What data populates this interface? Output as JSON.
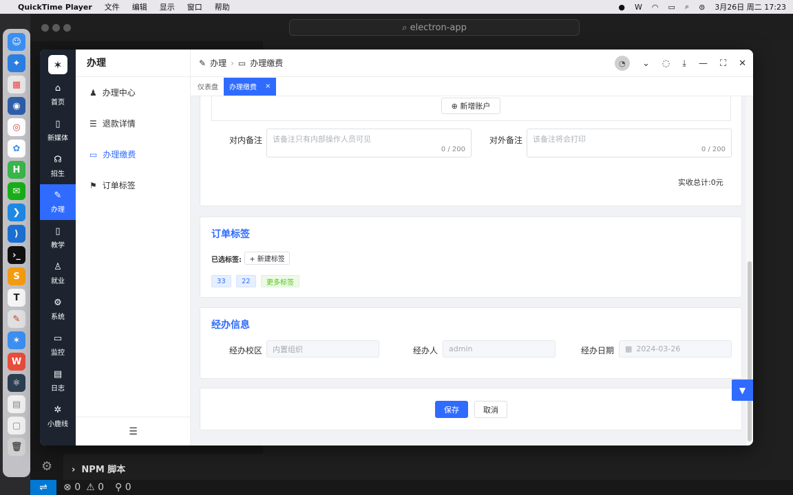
{
  "menubar": {
    "app": "QuickTime Player",
    "items": [
      "文件",
      "编辑",
      "显示",
      "窗口",
      "帮助"
    ],
    "datetime": "3月26日 周二  17:23"
  },
  "vscode": {
    "search": "electron-app",
    "npm": "NPM 脚本",
    "status_errors": "0",
    "status_warnings": "0",
    "status_ports": "0"
  },
  "rail": {
    "items": [
      {
        "label": "首页",
        "icon": "home-icon"
      },
      {
        "label": "新媒体",
        "icon": "tablet-icon"
      },
      {
        "label": "招生",
        "icon": "headset-icon"
      },
      {
        "label": "办理",
        "icon": "edit-icon"
      },
      {
        "label": "教学",
        "icon": "phone-icon"
      },
      {
        "label": "就业",
        "icon": "user-icon"
      },
      {
        "label": "系统",
        "icon": "gear-icon"
      },
      {
        "label": "监控",
        "icon": "monitor-icon"
      },
      {
        "label": "日志",
        "icon": "log-icon"
      },
      {
        "label": "小鹿线",
        "icon": "bug-icon"
      }
    ]
  },
  "menu": {
    "title": "办理",
    "items": [
      "办理中心",
      "退款详情",
      "办理缴费",
      "订单标签"
    ]
  },
  "breadcrumb": {
    "root": "办理",
    "current": "办理缴费"
  },
  "tabs": {
    "dashboard": "仪表盘",
    "active": "办理缴费"
  },
  "form": {
    "add_account": "新增账户",
    "internal_note_label": "对内备注",
    "internal_note_placeholder": "该备注只有内部操作人员可见",
    "internal_note_count": "0 / 200",
    "external_note_label": "对外备注",
    "external_note_placeholder": "该备注将会打印",
    "external_note_count": "0 / 200",
    "total": "实收总计:0元"
  },
  "tags_section": {
    "title": "订单标签",
    "selected_label": "已选标签:",
    "new_tag": "+ 新建标签",
    "tags": [
      "33",
      "22"
    ],
    "more": "更多标签"
  },
  "handler_section": {
    "title": "经办信息",
    "campus_label": "经办校区",
    "campus_placeholder": "内置组织",
    "handler_label": "经办人",
    "handler_value": "admin",
    "date_label": "经办日期",
    "date_value": "2024-03-26"
  },
  "actions": {
    "save": "保存",
    "cancel": "取消"
  }
}
